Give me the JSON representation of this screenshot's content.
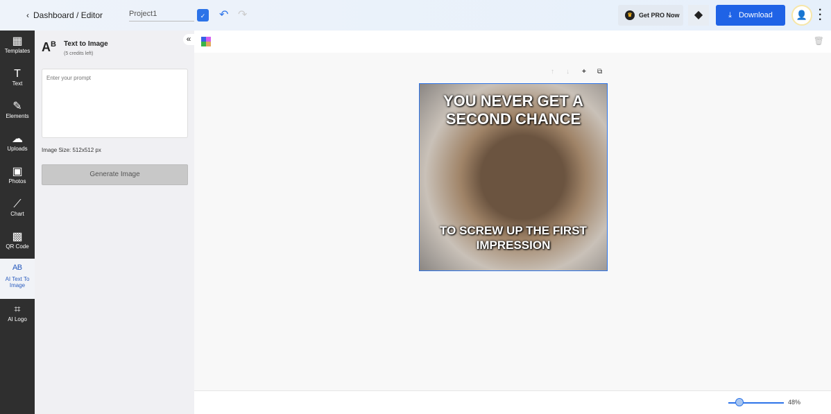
{
  "header": {
    "breadcrumb": "Dashboard / Editor",
    "project_name": "Project1",
    "pro_label": "Get PRO Now",
    "download_label": "Download"
  },
  "sidebar": {
    "items": [
      {
        "label": "Templates",
        "icon": "grid-icon",
        "glyph": "▦"
      },
      {
        "label": "Text",
        "icon": "text-icon",
        "glyph": "T"
      },
      {
        "label": "Elements",
        "icon": "pen-icon",
        "glyph": "✎"
      },
      {
        "label": "Uploads",
        "icon": "upload-cloud-icon",
        "glyph": "☁"
      },
      {
        "label": "Photos",
        "icon": "photo-icon",
        "glyph": "▣"
      },
      {
        "label": "Chart",
        "icon": "chart-icon",
        "glyph": "⟋"
      },
      {
        "label": "QR Code",
        "icon": "qr-icon",
        "glyph": "▩"
      },
      {
        "label": "AI Text To Image",
        "icon": "ai-text-image-icon",
        "glyph": "ᴬᴮ",
        "active": true
      },
      {
        "label": "AI Logo",
        "icon": "ai-logo-icon",
        "glyph": "⌗"
      }
    ]
  },
  "panel": {
    "title": "Text to Image",
    "credits": "(5 credits left)",
    "prompt_placeholder": "Enter your prompt",
    "image_size": "Image Size: 512x512 px",
    "generate_label": "Generate Image"
  },
  "canvas": {
    "top_caption": "YOU NEVER GET A SECOND CHANCE",
    "bottom_caption": "TO SCREW UP THE FIRST IMPRESSION"
  },
  "zoom": {
    "value": "48%",
    "level": 48
  },
  "colors": {
    "accent": "#1f63e6",
    "sidebar": "#2f2f2f"
  }
}
